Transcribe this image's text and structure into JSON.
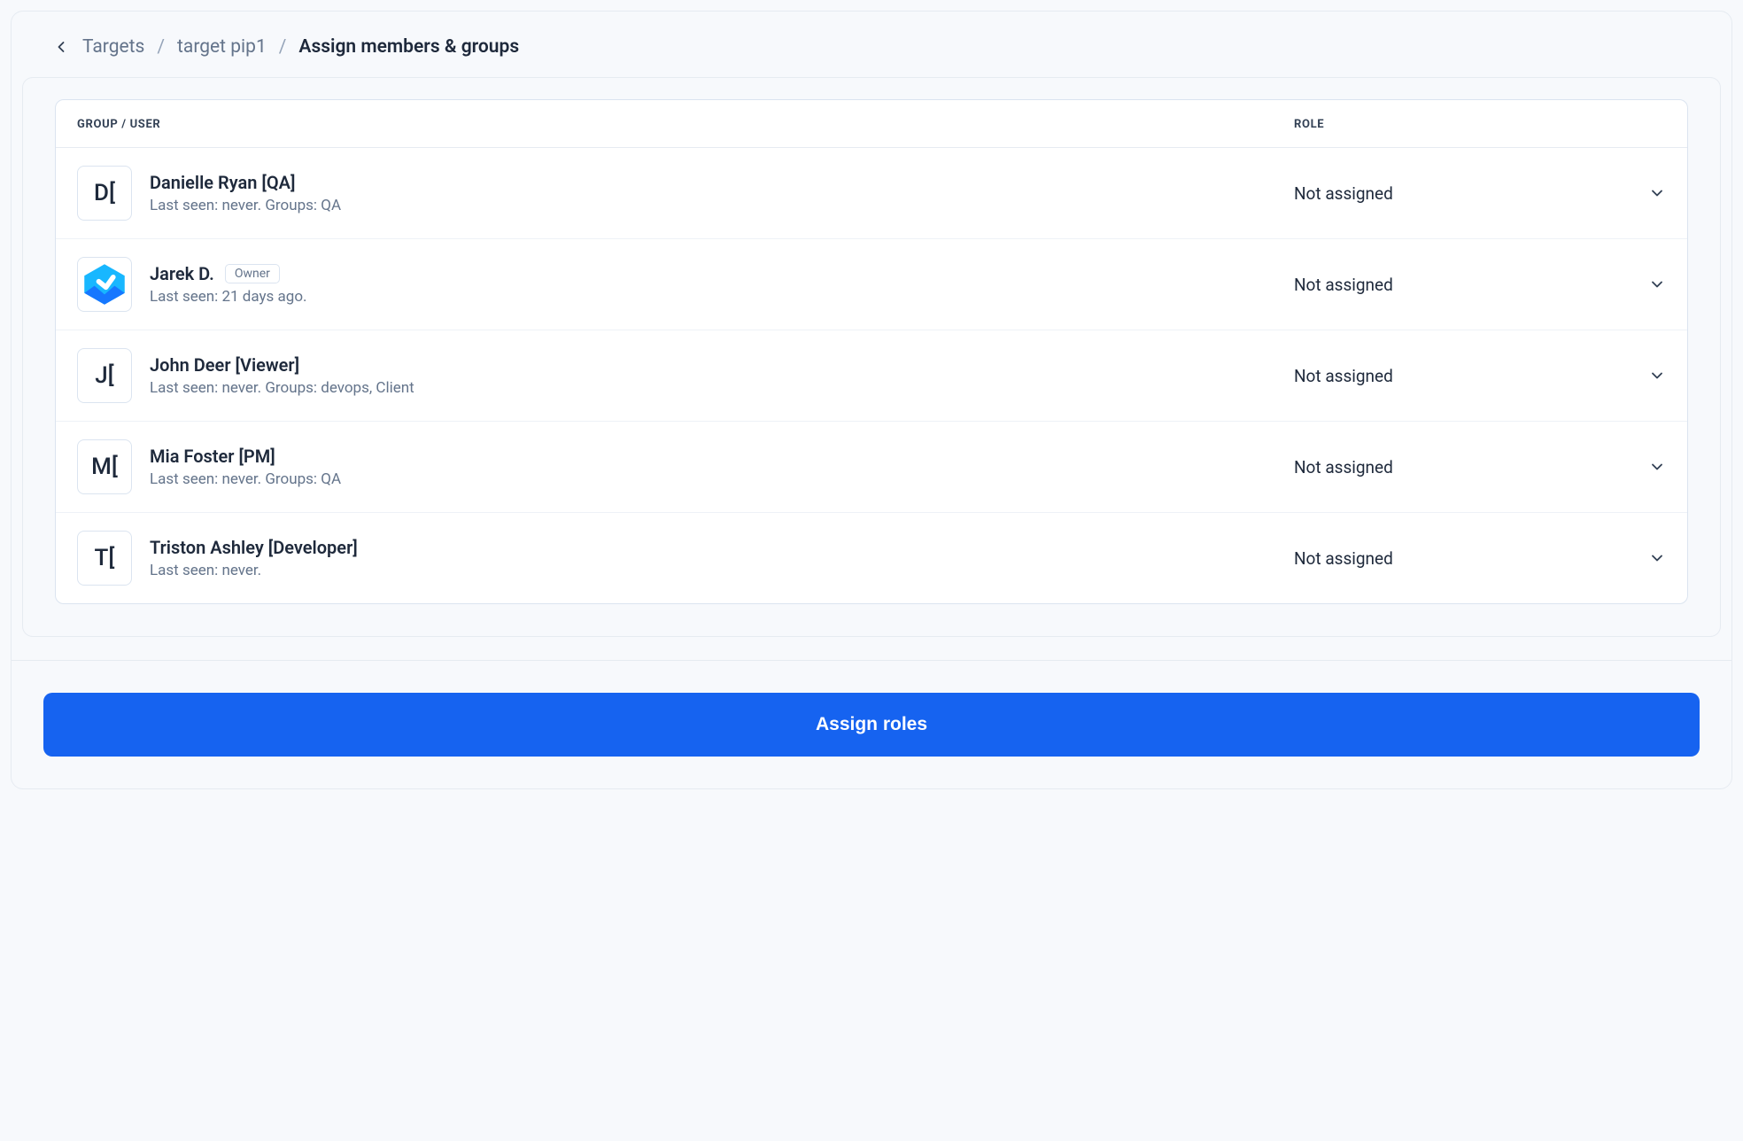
{
  "breadcrumb": {
    "back_icon": "chevron-left",
    "items": [
      {
        "label": "Targets"
      },
      {
        "label": "target pip1"
      }
    ],
    "current": "Assign members & groups"
  },
  "table": {
    "headers": {
      "group_user": "GROUP / USER",
      "role": "ROLE"
    },
    "rows": [
      {
        "avatar_text": "D[",
        "avatar_kind": "initials",
        "name": "Danielle Ryan [QA]",
        "badge": null,
        "meta": "Last seen: never. Groups: QA",
        "role": "Not assigned"
      },
      {
        "avatar_text": "",
        "avatar_kind": "logo",
        "name": "Jarek D.",
        "badge": "Owner",
        "meta": "Last seen: 21 days ago.",
        "role": "Not assigned"
      },
      {
        "avatar_text": "J[",
        "avatar_kind": "initials",
        "name": "John Deer [Viewer]",
        "badge": null,
        "meta": "Last seen: never. Groups: devops, Client",
        "role": "Not assigned"
      },
      {
        "avatar_text": "M[",
        "avatar_kind": "initials",
        "name": "Mia Foster [PM]",
        "badge": null,
        "meta": "Last seen: never. Groups: QA",
        "role": "Not assigned"
      },
      {
        "avatar_text": "T[",
        "avatar_kind": "initials",
        "name": "Triston Ashley [Developer]",
        "badge": null,
        "meta": "Last seen: never.",
        "role": "Not assigned"
      }
    ]
  },
  "footer": {
    "assign_button": "Assign roles"
  }
}
